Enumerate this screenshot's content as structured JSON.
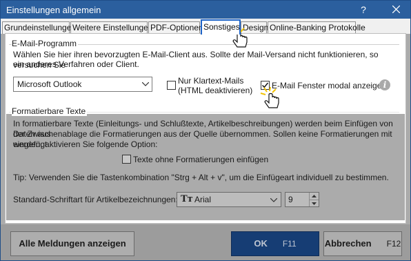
{
  "window": {
    "title": "Einstellungen allgemein",
    "help_label": "?",
    "colors": {
      "titlebar": "#2b5f9e",
      "active_tab_border": "#1e64c8",
      "primary_button": "#163d74"
    }
  },
  "tabs": [
    {
      "label": "Grundeinstellungen",
      "active": false
    },
    {
      "label": "Weitere Einstellungen",
      "active": false
    },
    {
      "label": "PDF-Optionen",
      "active": false
    },
    {
      "label": "Sonstiges",
      "active": true
    },
    {
      "label": "Design",
      "active": false
    },
    {
      "label": "Online-Banking Protokolle",
      "active": false
    }
  ],
  "email_group": {
    "title": "E-Mail-Programm",
    "description_line1": "Wählen Sie hier ihren bevorzugten E-Mail-Client aus. Sollte der Mail-Versand nicht funktionieren, so versuchen Sie",
    "description_line2": "ein anderes Verfahren oder Client.",
    "client_selected": "Microsoft Outlook",
    "plaintext_label_line1": "Nur Klartext-Mails",
    "plaintext_label_line2": "(HTML deaktivieren)",
    "plaintext_checked": false,
    "modal_label": "E-Mail Fenster modal anzeigen",
    "modal_checked": true,
    "info_icon": "i"
  },
  "format_group": {
    "title": "Formatierbare Texte",
    "description_line1": "In formatierbare Texte (Einleitungs- und Schlußtexte, Artikelbeschreibungen) werden beim Einfügen von Daten aus",
    "description_line2": "der Zwischenablage die Formatierungen aus der Quelle übernommen. Sollen keine Formatierungen mit eingefügt",
    "description_line3": "werden, aktivieren Sie folgende Option:",
    "no_format_label": "Texte ohne Formatierungen einfügen",
    "no_format_checked": false,
    "tip": "Tip: Verwenden Sie die Tastenkombination \"Strg + Alt + v\", um die Einfügeart individuell zu bestimmen.",
    "font_label": "Standard-Schriftart für Artikelbezeichnungen:",
    "font_name": "Arial",
    "font_size": "9"
  },
  "footer": {
    "show_messages_label": "Alle Meldungen anzeigen",
    "ok_label": "OK",
    "ok_key": "F11",
    "cancel_label": "Abbrechen",
    "cancel_key": "F12"
  }
}
